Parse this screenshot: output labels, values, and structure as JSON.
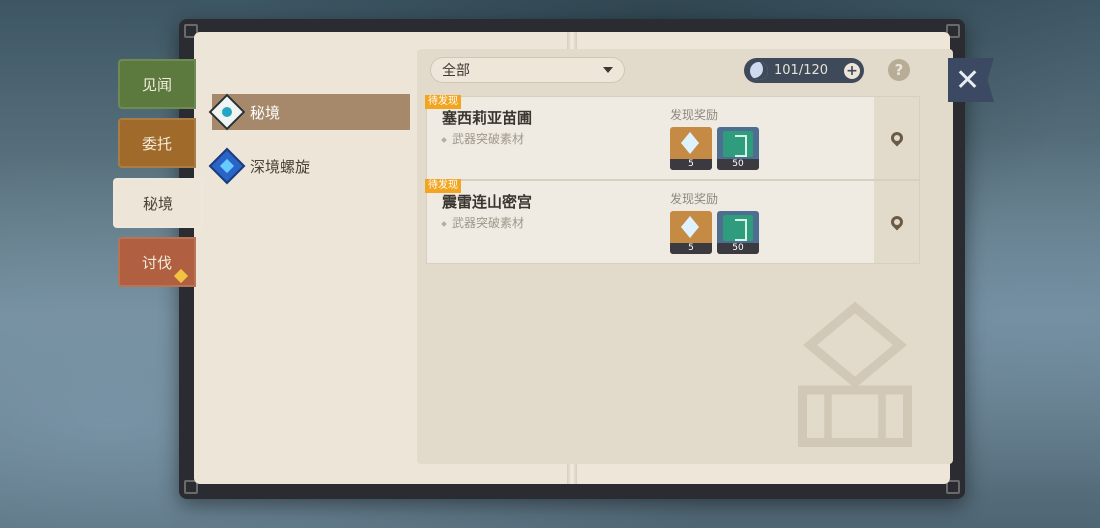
{
  "side_tabs": [
    {
      "label": "见闻"
    },
    {
      "label": "委托"
    },
    {
      "label": "秘境"
    },
    {
      "label": "讨伐"
    }
  ],
  "categories": [
    {
      "label": "秘境",
      "icon": "domain-icon",
      "active": true
    },
    {
      "label": "深境螺旋",
      "icon": "spiral-abyss-icon",
      "active": false
    }
  ],
  "filter": {
    "selected": "全部"
  },
  "resin": {
    "value": "101/120",
    "plus": "+"
  },
  "help": "?",
  "close": "✕",
  "domains": [
    {
      "badge": "待发现",
      "name": "塞西莉亚苗圃",
      "sub": "武器突破素材",
      "reward_title": "发现奖励",
      "rewards": [
        {
          "icon": "primogem-icon",
          "count": "5"
        },
        {
          "icon": "adventure-exp-icon",
          "count": "50"
        }
      ]
    },
    {
      "badge": "待发现",
      "name": "震雷连山密宫",
      "sub": "武器突破素材",
      "reward_title": "发现奖励",
      "rewards": [
        {
          "icon": "primogem-icon",
          "count": "5"
        },
        {
          "icon": "adventure-exp-icon",
          "count": "50"
        }
      ]
    }
  ],
  "colors": {
    "tab_jianwen": "#5d7a3e",
    "tab_weituo": "#a06a2a",
    "tab_taofa": "#b06040",
    "badge": "#f1a520",
    "active_category": "#a6896a"
  }
}
